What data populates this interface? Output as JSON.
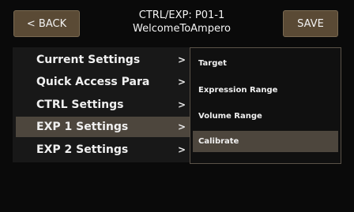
{
  "header": {
    "back_label": "< BACK",
    "title_line1": "CTRL/EXP: P01-1",
    "title_line2": "WelcomeToAmpero",
    "save_label": "SAVE"
  },
  "left_menu": {
    "items": [
      {
        "label": "Current Settings",
        "arrow": ">"
      },
      {
        "label": "Quick Access Para",
        "arrow": ">"
      },
      {
        "label": "CTRL Settings",
        "arrow": ">"
      },
      {
        "label": "EXP 1 Settings",
        "arrow": ">",
        "selected": true
      },
      {
        "label": "EXP 2 Settings",
        "arrow": ">"
      }
    ]
  },
  "right_menu": {
    "items": [
      {
        "label": "Target"
      },
      {
        "label": "Expression Range"
      },
      {
        "label": "Volume Range"
      },
      {
        "label": "Calibrate",
        "selected": true
      }
    ]
  },
  "colors": {
    "background": "#0a0a0a",
    "button": "#5a4a35",
    "selected_row": "#4d463d",
    "panel": "#181818"
  }
}
